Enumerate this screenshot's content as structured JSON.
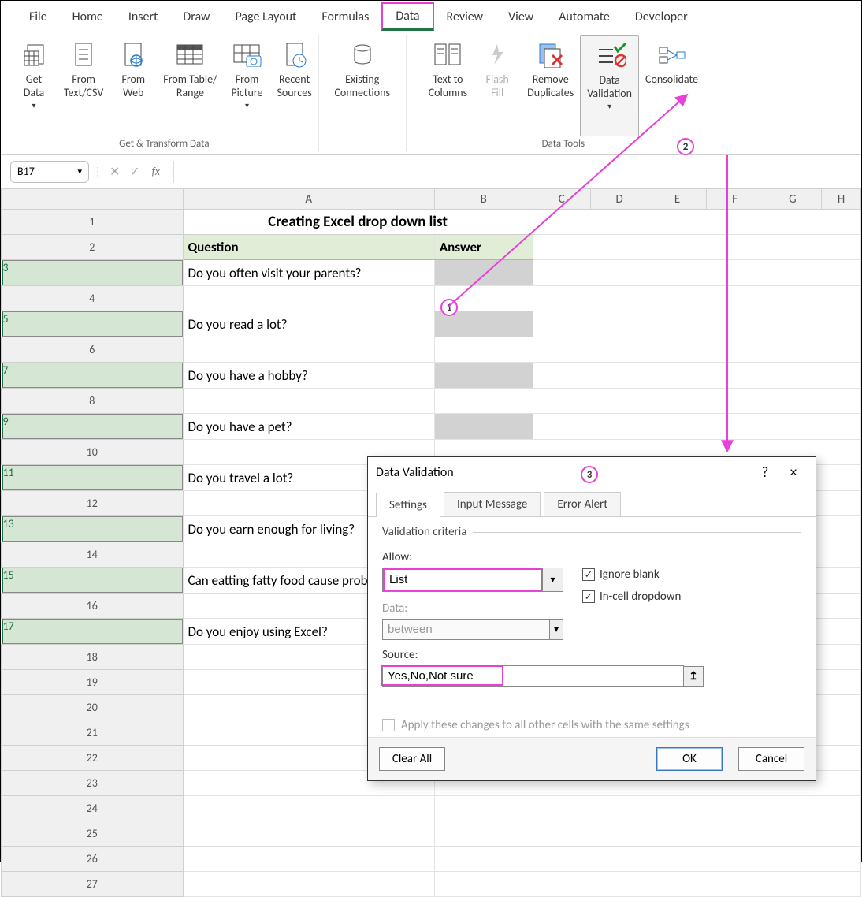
{
  "menu": {
    "tabs": [
      "File",
      "Home",
      "Insert",
      "Draw",
      "Page Layout",
      "Formulas",
      "Data",
      "Review",
      "View",
      "Automate",
      "Developer"
    ],
    "active": "Data"
  },
  "ribbon": {
    "group1_caption": "Get & Transform Data",
    "group2_caption": "Data Tools",
    "get_data": "Get\nData",
    "from_csv": "From\nText/CSV",
    "from_web": "From\nWeb",
    "from_table": "From Table/\nRange",
    "from_picture": "From\nPicture",
    "recent_sources": "Recent\nSources",
    "existing_conn": "Existing\nConnections",
    "text_to_cols": "Text to\nColumns",
    "flash_fill": "Flash\nFill",
    "remove_dup": "Remove\nDuplicates",
    "data_validation": "Data\nValidation",
    "consolidate": "Consolidate"
  },
  "namebox": "B17",
  "formula": "",
  "sheet": {
    "cols": [
      "A",
      "B",
      "C",
      "D",
      "E",
      "F",
      "G",
      "H"
    ],
    "title": "Creating Excel drop down list",
    "hdr_question": "Question",
    "hdr_answer": "Answer",
    "rows": [
      {
        "n": 3,
        "q": "Do you often visit your parents?",
        "grey": true
      },
      {
        "n": 4,
        "q": "",
        "grey": false
      },
      {
        "n": 5,
        "q": "Do you read a lot?",
        "grey": true
      },
      {
        "n": 6,
        "q": "",
        "grey": false
      },
      {
        "n": 7,
        "q": "Do you have a hobby?",
        "grey": true
      },
      {
        "n": 8,
        "q": "",
        "grey": false
      },
      {
        "n": 9,
        "q": "Do you have a pet?",
        "grey": true
      },
      {
        "n": 10,
        "q": "",
        "grey": false
      },
      {
        "n": 11,
        "q": "Do you travel a lot?",
        "grey": true
      },
      {
        "n": 12,
        "q": "",
        "grey": false
      },
      {
        "n": 13,
        "q": "Do you earn enough for living?",
        "grey": true
      },
      {
        "n": 14,
        "q": "",
        "grey": false
      },
      {
        "n": 15,
        "q": "Can eatting fatty food cause problems?",
        "grey": true
      },
      {
        "n": 16,
        "q": "",
        "grey": false
      },
      {
        "n": 17,
        "q": "Do you enjoy using Excel?",
        "grey": false
      }
    ],
    "empty_rows": [
      18,
      19,
      20,
      21,
      22,
      23,
      24,
      25,
      26,
      27
    ]
  },
  "dialog": {
    "title": "Data Validation",
    "help": "?",
    "close": "×",
    "tabs": [
      "Settings",
      "Input Message",
      "Error Alert"
    ],
    "active_tab": "Settings",
    "criteria_legend": "Validation criteria",
    "allow_label": "Allow:",
    "allow_value": "List",
    "data_label": "Data:",
    "data_value": "between",
    "source_label": "Source:",
    "source_value": "Yes,No,Not sure",
    "ignore_blank": "Ignore blank",
    "incell_dd": "In-cell dropdown",
    "apply_label": "Apply these changes to all other cells with the same settings",
    "btn_clear": "Clear All",
    "btn_ok": "OK",
    "btn_cancel": "Cancel"
  },
  "callouts": {
    "c1": "1",
    "c2": "2",
    "c3": "3"
  }
}
